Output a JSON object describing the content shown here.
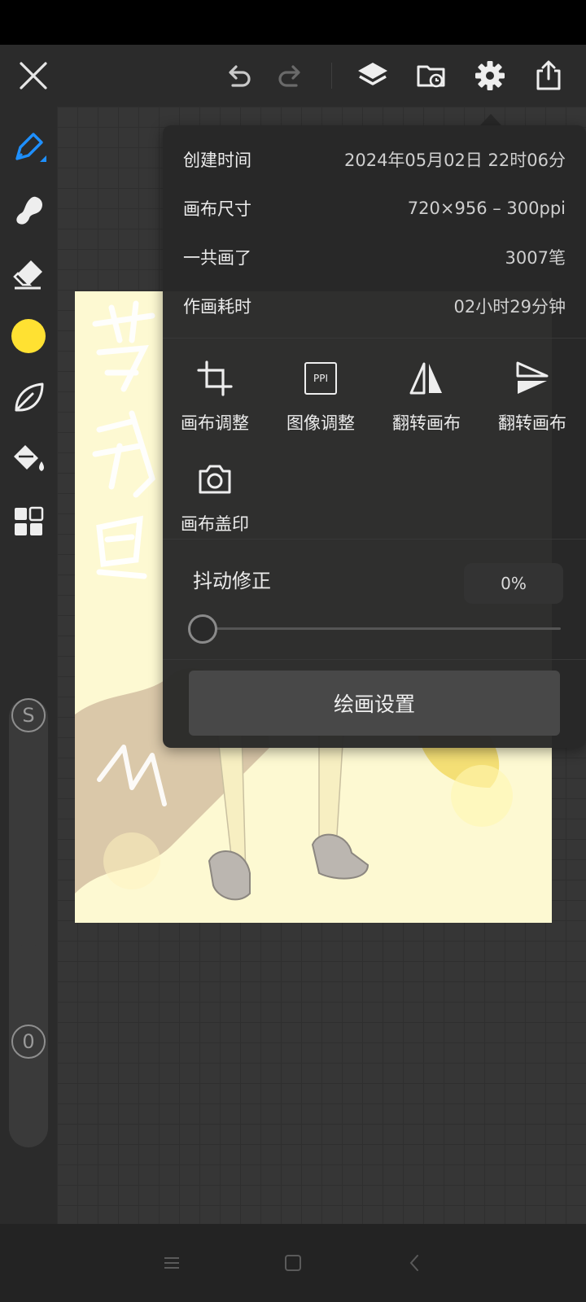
{
  "toolbar": {
    "close_icon": "close-icon",
    "undo_icon": "undo-icon",
    "redo_icon": "redo-icon",
    "layers_icon": "layers-icon",
    "folder_icon": "folder-sync-icon",
    "settings_icon": "gear-icon",
    "share_icon": "share-icon"
  },
  "tools": [
    {
      "name": "pen-tool",
      "icon": "pen-icon"
    },
    {
      "name": "smudge-tool",
      "icon": "smudge-icon"
    },
    {
      "name": "eraser-tool",
      "icon": "eraser-icon"
    },
    {
      "name": "color-picker",
      "icon": "color-swatch",
      "color": "#ffe132"
    },
    {
      "name": "brush-library",
      "icon": "leaf-icon"
    },
    {
      "name": "fill-tool",
      "icon": "paint-bucket-icon"
    },
    {
      "name": "more-tools",
      "icon": "grid-icon"
    }
  ],
  "sliders": {
    "size_label": "S",
    "opacity_label": "0"
  },
  "canvas_info": {
    "rows": [
      {
        "label": "创建时间",
        "value": "2024年05月02日 22时06分"
      },
      {
        "label": "画布尺寸",
        "value": "720×956 – 300ppi"
      },
      {
        "label": "一共画了",
        "value": "3007笔"
      },
      {
        "label": "作画耗时",
        "value": "02小时29分钟"
      }
    ]
  },
  "actions": [
    {
      "label": "画布调整",
      "icon": "crop-icon"
    },
    {
      "label": "图像调整",
      "icon": "ppi-icon",
      "icon_text": "PPI"
    },
    {
      "label": "翻转画布",
      "icon": "flip-horizontal-icon"
    },
    {
      "label": "翻转画布",
      "icon": "flip-vertical-icon"
    },
    {
      "label": "画布盖印",
      "icon": "camera-icon"
    }
  ],
  "stabilizer": {
    "label": "抖动修正",
    "value": "0%",
    "level": 0
  },
  "settings_button": "绘画设置",
  "colors": {
    "accent_blue": "#1e90ff",
    "active_color": "#ffe132",
    "canvas_bg": "#fdf9d2"
  }
}
